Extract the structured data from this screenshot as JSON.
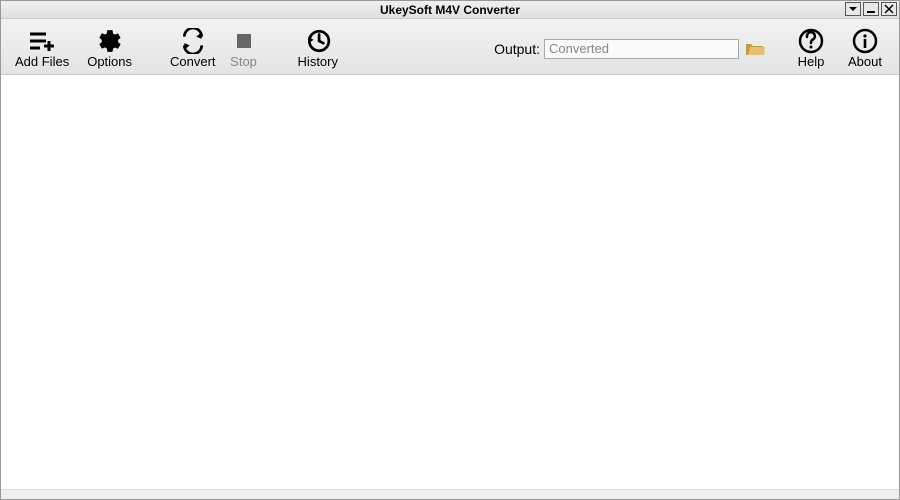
{
  "title": "UkeySoft M4V Converter",
  "toolbar": {
    "add_files_label": "Add Files",
    "options_label": "Options",
    "convert_label": "Convert",
    "stop_label": "Stop",
    "history_label": "History",
    "output_label": "Output:",
    "output_value": "Converted",
    "help_label": "Help",
    "about_label": "About"
  }
}
